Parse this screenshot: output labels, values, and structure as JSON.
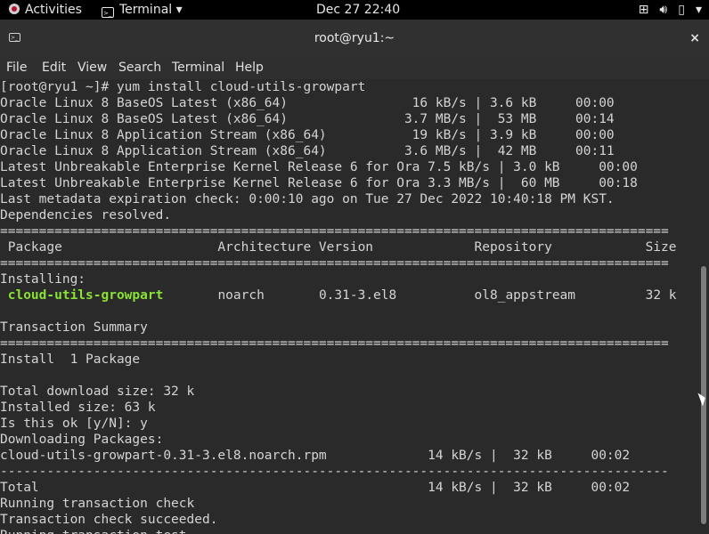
{
  "topbar": {
    "activities": "Activities",
    "app": "Terminal",
    "clock": "Dec 27  22:40",
    "icons": [
      "network-icon",
      "volume-icon",
      "battery-icon",
      "system-menu-icon"
    ]
  },
  "window": {
    "title": "root@ryu1:~",
    "close": "×"
  },
  "menu": [
    "File",
    "Edit",
    "View",
    "Search",
    "Terminal",
    "Help"
  ],
  "terminal": {
    "lines": [
      "[root@ryu1 ~]# yum install cloud-utils-growpart",
      "Oracle Linux 8 BaseOS Latest (x86_64)                16 kB/s | 3.6 kB     00:00",
      "Oracle Linux 8 BaseOS Latest (x86_64)               3.7 MB/s |  53 MB     00:14",
      "Oracle Linux 8 Application Stream (x86_64)           19 kB/s | 3.9 kB     00:00",
      "Oracle Linux 8 Application Stream (x86_64)          3.6 MB/s |  42 MB     00:11",
      "Latest Unbreakable Enterprise Kernel Release 6 for Ora 7.5 kB/s | 3.0 kB     00:00",
      "Latest Unbreakable Enterprise Kernel Release 6 for Ora 3.3 MB/s |  60 MB     00:18",
      "Last metadata expiration check: 0:00:10 ago on Tue 27 Dec 2022 10:40:18 PM KST.",
      "Dependencies resolved.",
      "======================================================================================",
      " Package                    Architecture Version             Repository            Size",
      "======================================================================================",
      "Installing:",
      " cloud-utils-growpart       noarch       0.31-3.el8          ol8_appstream         32 k",
      "",
      "Transaction Summary",
      "======================================================================================",
      "Install  1 Package",
      "",
      "Total download size: 32 k",
      "Installed size: 63 k",
      "Is this ok [y/N]: y",
      "Downloading Packages:",
      "cloud-utils-growpart-0.31-3.el8.noarch.rpm             14 kB/s |  32 kB     00:02",
      "--------------------------------------------------------------------------------------",
      "Total                                                  14 kB/s |  32 kB     00:02",
      "Running transaction check",
      "Transaction check succeeded.",
      "Running transaction test"
    ],
    "highlight_line": 13,
    "highlight_text": "cloud-utils-growpart",
    "highlight_color": "#8ae234"
  }
}
